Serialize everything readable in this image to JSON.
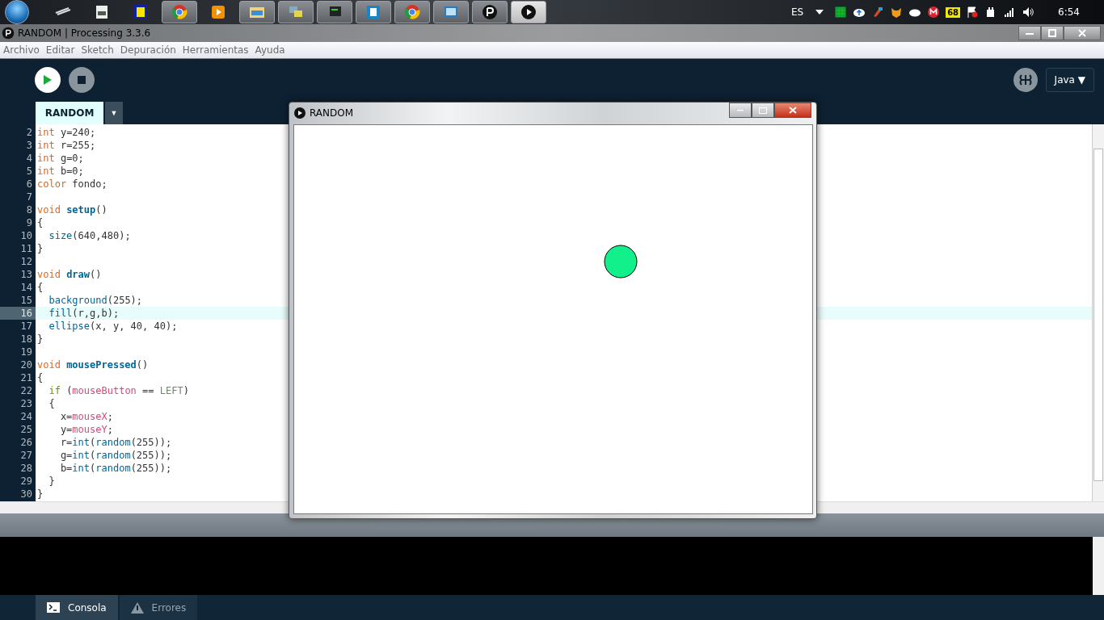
{
  "taskbar": {
    "apps": [
      {
        "kind": "tool",
        "running": false,
        "active": false
      },
      {
        "kind": "window",
        "running": false,
        "active": false
      },
      {
        "kind": "notes",
        "running": false,
        "active": false
      },
      {
        "kind": "browser",
        "running": true,
        "active": false
      },
      {
        "kind": "player",
        "running": false,
        "active": false
      },
      {
        "kind": "folder",
        "running": true,
        "active": false
      },
      {
        "kind": "chat",
        "running": true,
        "active": false
      },
      {
        "kind": "terminal",
        "running": true,
        "active": false
      },
      {
        "kind": "editor",
        "running": true,
        "active": false
      },
      {
        "kind": "browser",
        "running": true,
        "active": false
      },
      {
        "kind": "photo",
        "running": true,
        "active": false
      },
      {
        "kind": "processing",
        "running": true,
        "active": false
      },
      {
        "kind": "sketch",
        "running": true,
        "active": true
      }
    ],
    "tray": {
      "language": "ES",
      "icons": [
        {
          "kind": "grid"
        },
        {
          "kind": "cloud-up"
        },
        {
          "kind": "cleaner"
        },
        {
          "kind": "fox"
        },
        {
          "kind": "cloud"
        },
        {
          "kind": "mega"
        },
        {
          "kind": "badge",
          "text": "68"
        },
        {
          "kind": "flag"
        },
        {
          "kind": "power"
        },
        {
          "kind": "signal"
        },
        {
          "kind": "volume"
        }
      ],
      "clock": "6:54"
    }
  },
  "window": {
    "title": "RANDOM | Processing 3.3.6"
  },
  "menu": [
    "Archivo",
    "Editar",
    "Sketch",
    "Depuración",
    "Herramientas",
    "Ayuda"
  ],
  "toolbar": {
    "mode": "Java ▼"
  },
  "tabs": [
    {
      "label": "RANDOM",
      "selected": true
    }
  ],
  "tab_menu": "▼",
  "editor": {
    "lines": [
      {
        "number": "2",
        "current": false,
        "tokens": [
          {
            "kind": "type",
            "text": "int"
          },
          {
            "kind": "plain",
            "text": " y=240;"
          }
        ]
      },
      {
        "number": "3",
        "current": false,
        "tokens": [
          {
            "kind": "type",
            "text": "int"
          },
          {
            "kind": "plain",
            "text": " r=255;"
          }
        ]
      },
      {
        "number": "4",
        "current": false,
        "tokens": [
          {
            "kind": "type",
            "text": "int"
          },
          {
            "kind": "plain",
            "text": " g=0;"
          }
        ]
      },
      {
        "number": "5",
        "current": false,
        "tokens": [
          {
            "kind": "type",
            "text": "int"
          },
          {
            "kind": "plain",
            "text": " b=0;"
          }
        ]
      },
      {
        "number": "6",
        "current": false,
        "tokens": [
          {
            "kind": "type",
            "text": "color"
          },
          {
            "kind": "plain",
            "text": " fondo;"
          }
        ]
      },
      {
        "number": "7",
        "current": false
      },
      {
        "number": "8",
        "current": false,
        "tokens": [
          {
            "kind": "type",
            "text": "void "
          },
          {
            "kind": "def",
            "text": "setup"
          },
          {
            "kind": "plain",
            "text": "()"
          }
        ]
      },
      {
        "number": "9",
        "current": false,
        "tokens": [
          {
            "kind": "plain",
            "text": "{"
          }
        ]
      },
      {
        "number": "10",
        "current": false,
        "tokens": [
          {
            "kind": "fn",
            "text": "  size"
          },
          {
            "kind": "plain",
            "text": "(640,480);"
          }
        ]
      },
      {
        "number": "11",
        "current": false,
        "tokens": [
          {
            "kind": "plain",
            "text": "}"
          }
        ]
      },
      {
        "number": "12",
        "current": false
      },
      {
        "number": "13",
        "current": false,
        "tokens": [
          {
            "kind": "type",
            "text": "void "
          },
          {
            "kind": "def",
            "text": "draw"
          },
          {
            "kind": "plain",
            "text": "()"
          }
        ]
      },
      {
        "number": "14",
        "current": false,
        "tokens": [
          {
            "kind": "plain",
            "text": "{"
          }
        ]
      },
      {
        "number": "15",
        "current": false,
        "tokens": [
          {
            "kind": "fn",
            "text": "  background"
          },
          {
            "kind": "plain",
            "text": "(255);"
          }
        ]
      },
      {
        "number": "16",
        "current": true,
        "tokens": [
          {
            "kind": "fn",
            "text": "  fill"
          },
          {
            "kind": "plain",
            "text": "(r,g,b);"
          }
        ]
      },
      {
        "number": "17",
        "current": false,
        "tokens": [
          {
            "kind": "fn",
            "text": "  ellipse"
          },
          {
            "kind": "plain",
            "text": "(x, y, 40, 40);"
          }
        ]
      },
      {
        "number": "18",
        "current": false,
        "tokens": [
          {
            "kind": "plain",
            "text": "}"
          }
        ]
      },
      {
        "number": "19",
        "current": false
      },
      {
        "number": "20",
        "current": false,
        "tokens": [
          {
            "kind": "type",
            "text": "void "
          },
          {
            "kind": "def",
            "text": "mousePressed"
          },
          {
            "kind": "plain",
            "text": "()"
          }
        ]
      },
      {
        "number": "21",
        "current": false,
        "tokens": [
          {
            "kind": "plain",
            "text": "{"
          }
        ]
      },
      {
        "number": "22",
        "current": false,
        "tokens": [
          {
            "kind": "keyword",
            "text": "  if"
          },
          {
            "kind": "plain",
            "text": " ("
          },
          {
            "kind": "var",
            "text": "mouseButton"
          },
          {
            "kind": "plain",
            "text": " == "
          },
          {
            "kind": "const",
            "text": "LEFT"
          },
          {
            "kind": "plain",
            "text": ")"
          }
        ]
      },
      {
        "number": "23",
        "current": false,
        "tokens": [
          {
            "kind": "plain",
            "text": "  {"
          }
        ]
      },
      {
        "number": "24",
        "current": false,
        "tokens": [
          {
            "kind": "plain",
            "text": "    x="
          },
          {
            "kind": "var",
            "text": "mouseX"
          },
          {
            "kind": "plain",
            "text": ";"
          }
        ]
      },
      {
        "number": "25",
        "current": false,
        "tokens": [
          {
            "kind": "plain",
            "text": "    y="
          },
          {
            "kind": "var",
            "text": "mouseY"
          },
          {
            "kind": "plain",
            "text": ";"
          }
        ]
      },
      {
        "number": "26",
        "current": false,
        "tokens": [
          {
            "kind": "plain",
            "text": "    r="
          },
          {
            "kind": "fn",
            "text": "int"
          },
          {
            "kind": "plain",
            "text": "("
          },
          {
            "kind": "fn",
            "text": "random"
          },
          {
            "kind": "plain",
            "text": "(255));"
          }
        ]
      },
      {
        "number": "27",
        "current": false,
        "tokens": [
          {
            "kind": "plain",
            "text": "    g="
          },
          {
            "kind": "fn",
            "text": "int"
          },
          {
            "kind": "plain",
            "text": "("
          },
          {
            "kind": "fn",
            "text": "random"
          },
          {
            "kind": "plain",
            "text": "(255));"
          }
        ]
      },
      {
        "number": "28",
        "current": false,
        "tokens": [
          {
            "kind": "plain",
            "text": "    b="
          },
          {
            "kind": "fn",
            "text": "int"
          },
          {
            "kind": "plain",
            "text": "("
          },
          {
            "kind": "fn",
            "text": "random"
          },
          {
            "kind": "plain",
            "text": "(255));"
          }
        ]
      },
      {
        "number": "29",
        "current": false,
        "tokens": [
          {
            "kind": "plain",
            "text": "  }"
          }
        ]
      },
      {
        "number": "30",
        "current": false,
        "tokens": [
          {
            "kind": "plain",
            "text": "}"
          }
        ]
      }
    ]
  },
  "console_tabs": [
    {
      "label": "Consola",
      "kind": "console",
      "selected": true
    },
    {
      "label": "Errores",
      "kind": "errors",
      "selected": false
    }
  ],
  "sketch_window": {
    "title": "RANDOM",
    "circle": {
      "color": "#12f08c"
    }
  }
}
